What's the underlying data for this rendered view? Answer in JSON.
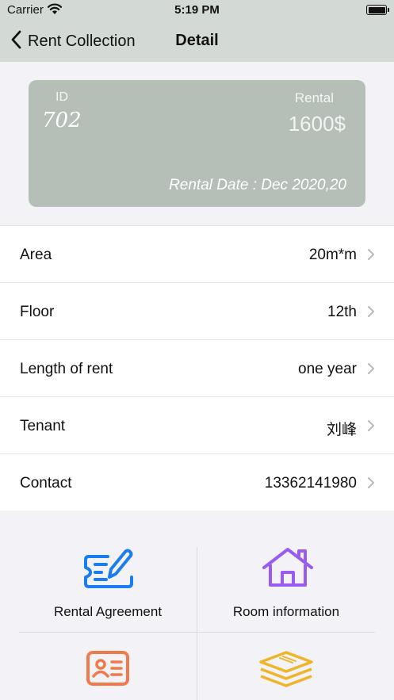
{
  "status_bar": {
    "carrier": "Carrier",
    "time": "5:19 PM"
  },
  "nav": {
    "back_label": "Rent Collection",
    "title": "Detail"
  },
  "card": {
    "id_label": "ID",
    "id_value": "702",
    "rental_label": "Rental",
    "rental_value": "1600$",
    "date_text": "Rental Date : Dec 2020,20"
  },
  "rows": [
    {
      "label": "Area",
      "value": "20m*m"
    },
    {
      "label": "Floor",
      "value": "12th"
    },
    {
      "label": "Length of rent",
      "value": "one year"
    },
    {
      "label": "Tenant",
      "value": "刘峰"
    },
    {
      "label": "Contact",
      "value": "13362141980"
    }
  ],
  "grid": [
    {
      "label": "Rental Agreement",
      "icon": "agreement-icon",
      "color": "#1a7df0"
    },
    {
      "label": "Room information",
      "icon": "house-icon",
      "color": "#9a5cf0"
    },
    {
      "label": "",
      "icon": "id-card-icon",
      "color": "#f07a4a"
    },
    {
      "label": "",
      "icon": "layers-icon",
      "color": "#f0b429"
    }
  ],
  "colors": {
    "nav_background": "#d3d9d5",
    "card_background": "#b5bfb8"
  }
}
